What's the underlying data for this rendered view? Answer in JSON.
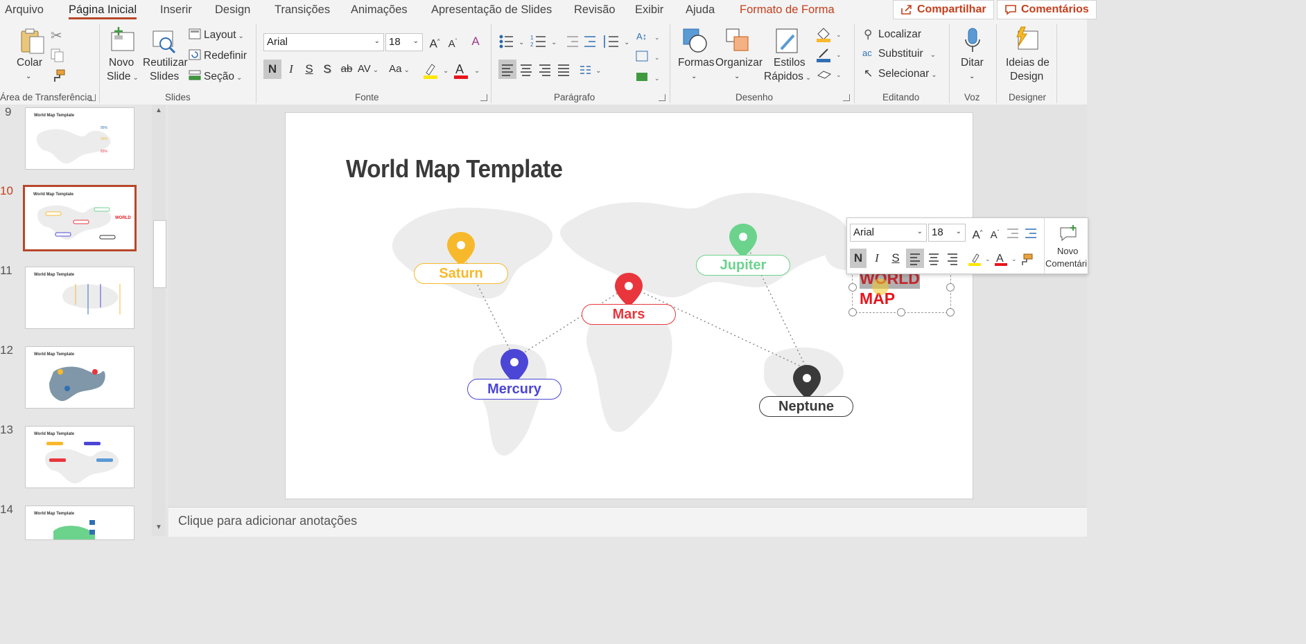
{
  "tabs": [
    "Arquivo",
    "Página Inicial",
    "Inserir",
    "Design",
    "Transições",
    "Animações",
    "Apresentação de Slides",
    "Revisão",
    "Exibir",
    "Ajuda",
    "Formato de Forma"
  ],
  "share": {
    "label": "Compartilhar"
  },
  "comments": {
    "label": "Comentários"
  },
  "ribbon": {
    "clipboard": {
      "paste": "Colar",
      "group": "Área de Transferência"
    },
    "slides": {
      "new_slide_1": "Novo",
      "new_slide_2": "Slide",
      "reuse_1": "Reutilizar",
      "reuse_2": "Slides",
      "layout": "Layout",
      "reset": "Redefinir",
      "section": "Seção",
      "group": "Slides"
    },
    "font": {
      "family": "Arial",
      "size": "18",
      "bold": "N",
      "italic": "I",
      "underline": "S",
      "shadow": "S",
      "strike": "ab",
      "spacing": "AV",
      "case": "Aa",
      "group": "Fonte"
    },
    "paragraph": {
      "group": "Parágrafo"
    },
    "drawing": {
      "shapes": "Formas",
      "arrange": "Organizar",
      "quick_styles_1": "Estilos",
      "quick_styles_2": "Rápidos",
      "group": "Desenho"
    },
    "editing": {
      "find": "Localizar",
      "replace": "Substituir",
      "select": "Selecionar",
      "group": "Editando"
    },
    "voice": {
      "dictate": "Ditar",
      "group": "Voz"
    },
    "designer": {
      "ideas_1": "Ideias de",
      "ideas_2": "Design",
      "group": "Designer"
    }
  },
  "thumbnails": [
    {
      "num": "9",
      "title": "World Map Template"
    },
    {
      "num": "10",
      "title": "World Map Template",
      "active": true
    },
    {
      "num": "11",
      "title": "World Map Template"
    },
    {
      "num": "12",
      "title": "World Map Template"
    },
    {
      "num": "13",
      "title": "World Map Template"
    },
    {
      "num": "14",
      "title": "World Map Template"
    }
  ],
  "slide": {
    "title": "World Map Template",
    "planets": [
      {
        "name": "Saturn",
        "color": "#f7b92b"
      },
      {
        "name": "Jupiter",
        "color": "#6bd38c"
      },
      {
        "name": "Mars",
        "color": "#e8363c"
      },
      {
        "name": "Mercury",
        "color": "#4b46d6"
      },
      {
        "name": "Neptune",
        "color": "#3a3a3a"
      }
    ],
    "textbox_line1": "WORLD",
    "textbox_line2": "MAP"
  },
  "mini_toolbar": {
    "font": "Arial",
    "size": "18",
    "bold": "N",
    "italic": "I",
    "underline": "S",
    "new_comment_1": "Novo",
    "new_comment_2": "Comentári"
  },
  "notes": {
    "placeholder": "Clique para adicionar anotações"
  },
  "colors": {
    "accent": "#b7472a",
    "contextual_tab": "#c43e1c",
    "highlight": "#ffe600",
    "font_color": "#e8141b"
  }
}
